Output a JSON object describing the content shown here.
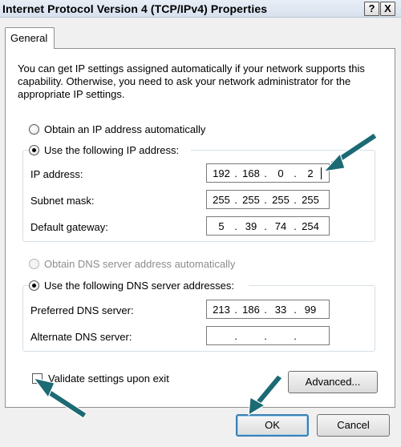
{
  "window": {
    "title": "Internet Protocol Version 4 (TCP/IPv4) Properties",
    "help_label": "?",
    "close_label": "X"
  },
  "tabs": [
    {
      "label": "General"
    }
  ],
  "description": "You can get IP settings assigned automatically if your network supports this capability. Otherwise, you need to ask your network administrator for the appropriate IP settings.",
  "ip": {
    "auto_label": "Obtain an IP address automatically",
    "manual_label": "Use the following IP address:",
    "selected": "manual",
    "fields": [
      {
        "label": "IP address:",
        "octets": [
          "192",
          "168",
          "0",
          "2"
        ]
      },
      {
        "label": "Subnet mask:",
        "octets": [
          "255",
          "255",
          "255",
          "255"
        ]
      },
      {
        "label": "Default gateway:",
        "octets": [
          "5",
          "39",
          "74",
          "254"
        ]
      }
    ]
  },
  "dns": {
    "auto_label": "Obtain DNS server address automatically",
    "manual_label": "Use the following DNS server addresses:",
    "selected": "manual",
    "fields": [
      {
        "label": "Preferred DNS server:",
        "octets": [
          "213",
          "186",
          "33",
          "99"
        ]
      },
      {
        "label": "Alternate DNS server:",
        "octets": [
          "",
          "",
          "",
          ""
        ]
      }
    ]
  },
  "validate": {
    "label": "Validate settings upon exit",
    "checked": false
  },
  "buttons": {
    "advanced": "Advanced...",
    "ok": "OK",
    "cancel": "Cancel"
  },
  "colors": {
    "annotation_arrow": "#1c6a73",
    "ok_focus_border": "#3c7fb1"
  },
  "icons": {
    "annotation": "arrow-icon"
  }
}
